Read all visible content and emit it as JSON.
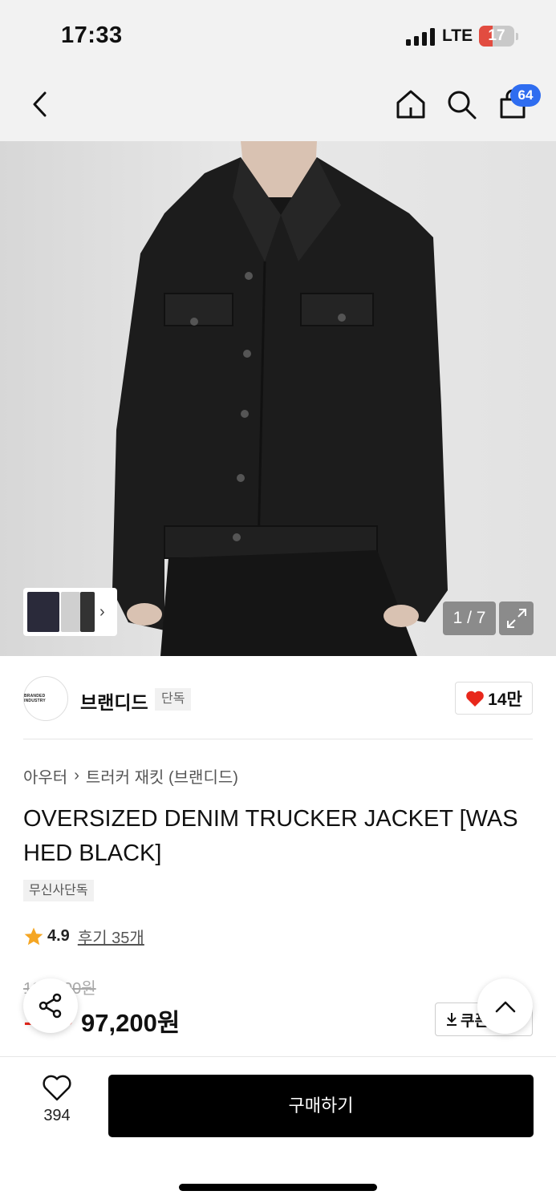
{
  "status_bar": {
    "time": "17:33",
    "network": "LTE",
    "battery_level": "17",
    "battery_color": "#e24c40"
  },
  "nav": {
    "back_icon": "chevron-left-icon",
    "home_icon": "home-icon",
    "search_icon": "search-icon",
    "cart_icon": "shopping-bag-icon",
    "cart_count": "64",
    "badge_color": "#2f6df0"
  },
  "gallery": {
    "page_indicator": "1 / 7",
    "current_page": 1,
    "total_pages": 7,
    "thumbnail_arrow": "›",
    "expand_icon": "expand-icon"
  },
  "brand": {
    "logo_text": "BRANDED INDUSTRY",
    "name": "브랜디드",
    "tag": "단독",
    "like_count": "14만",
    "heart_color": "#e8271b"
  },
  "product": {
    "breadcrumb": [
      "아우터",
      "트러커 재킷 (브랜디드)"
    ],
    "title": "OVERSIZED DENIM TRUCKER JACKET [WASHED BLACK]",
    "exclusive_tag": "무신사단독",
    "rating": "4.9",
    "review_label": "후기 35개",
    "rating_star_color": "#f5a623",
    "original_price": "108,000원",
    "discount_rate": "10%",
    "sale_price": "97,200원",
    "coupon_label": "쿠폰"
  },
  "bottom_bar": {
    "wish_count": "394",
    "buy_label": "구매하기"
  }
}
